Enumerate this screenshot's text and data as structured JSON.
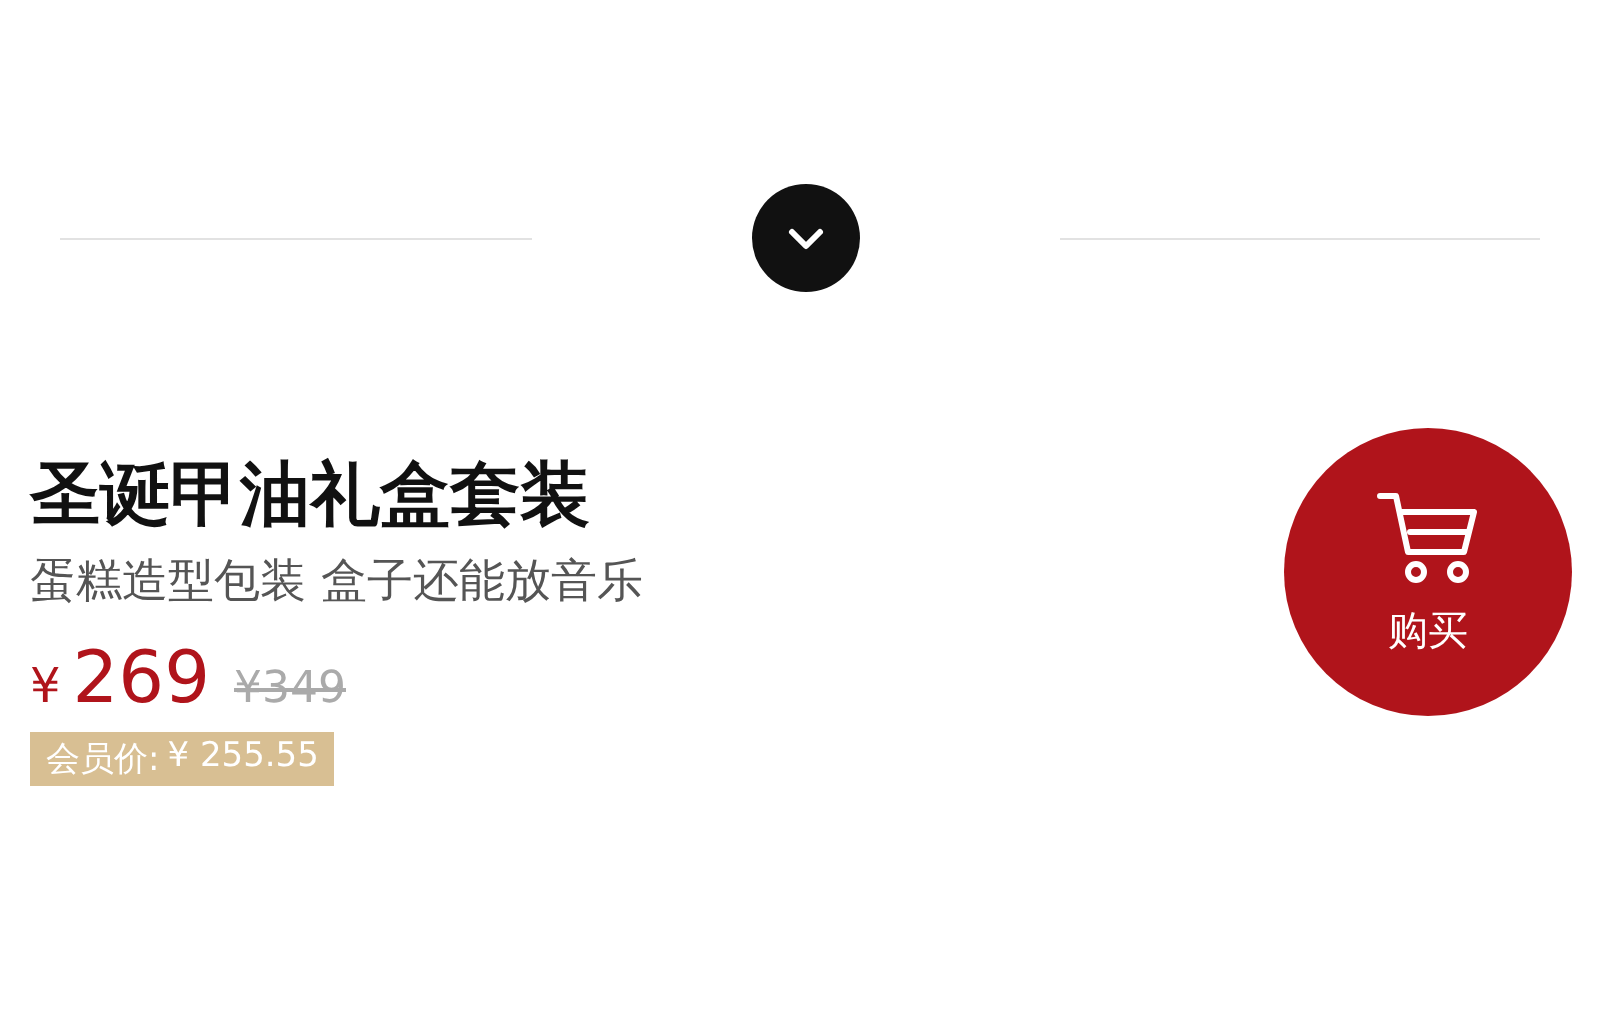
{
  "title": "圣诞甲油礼盒套装",
  "subtitle": "蛋糕造型包装 盒子还能放音乐",
  "price": {
    "currency": "¥",
    "amount": "269",
    "original": "¥349"
  },
  "member_price": {
    "label": "会员价:",
    "value": "¥ 255.55"
  },
  "buy_button": {
    "label": "购买"
  }
}
